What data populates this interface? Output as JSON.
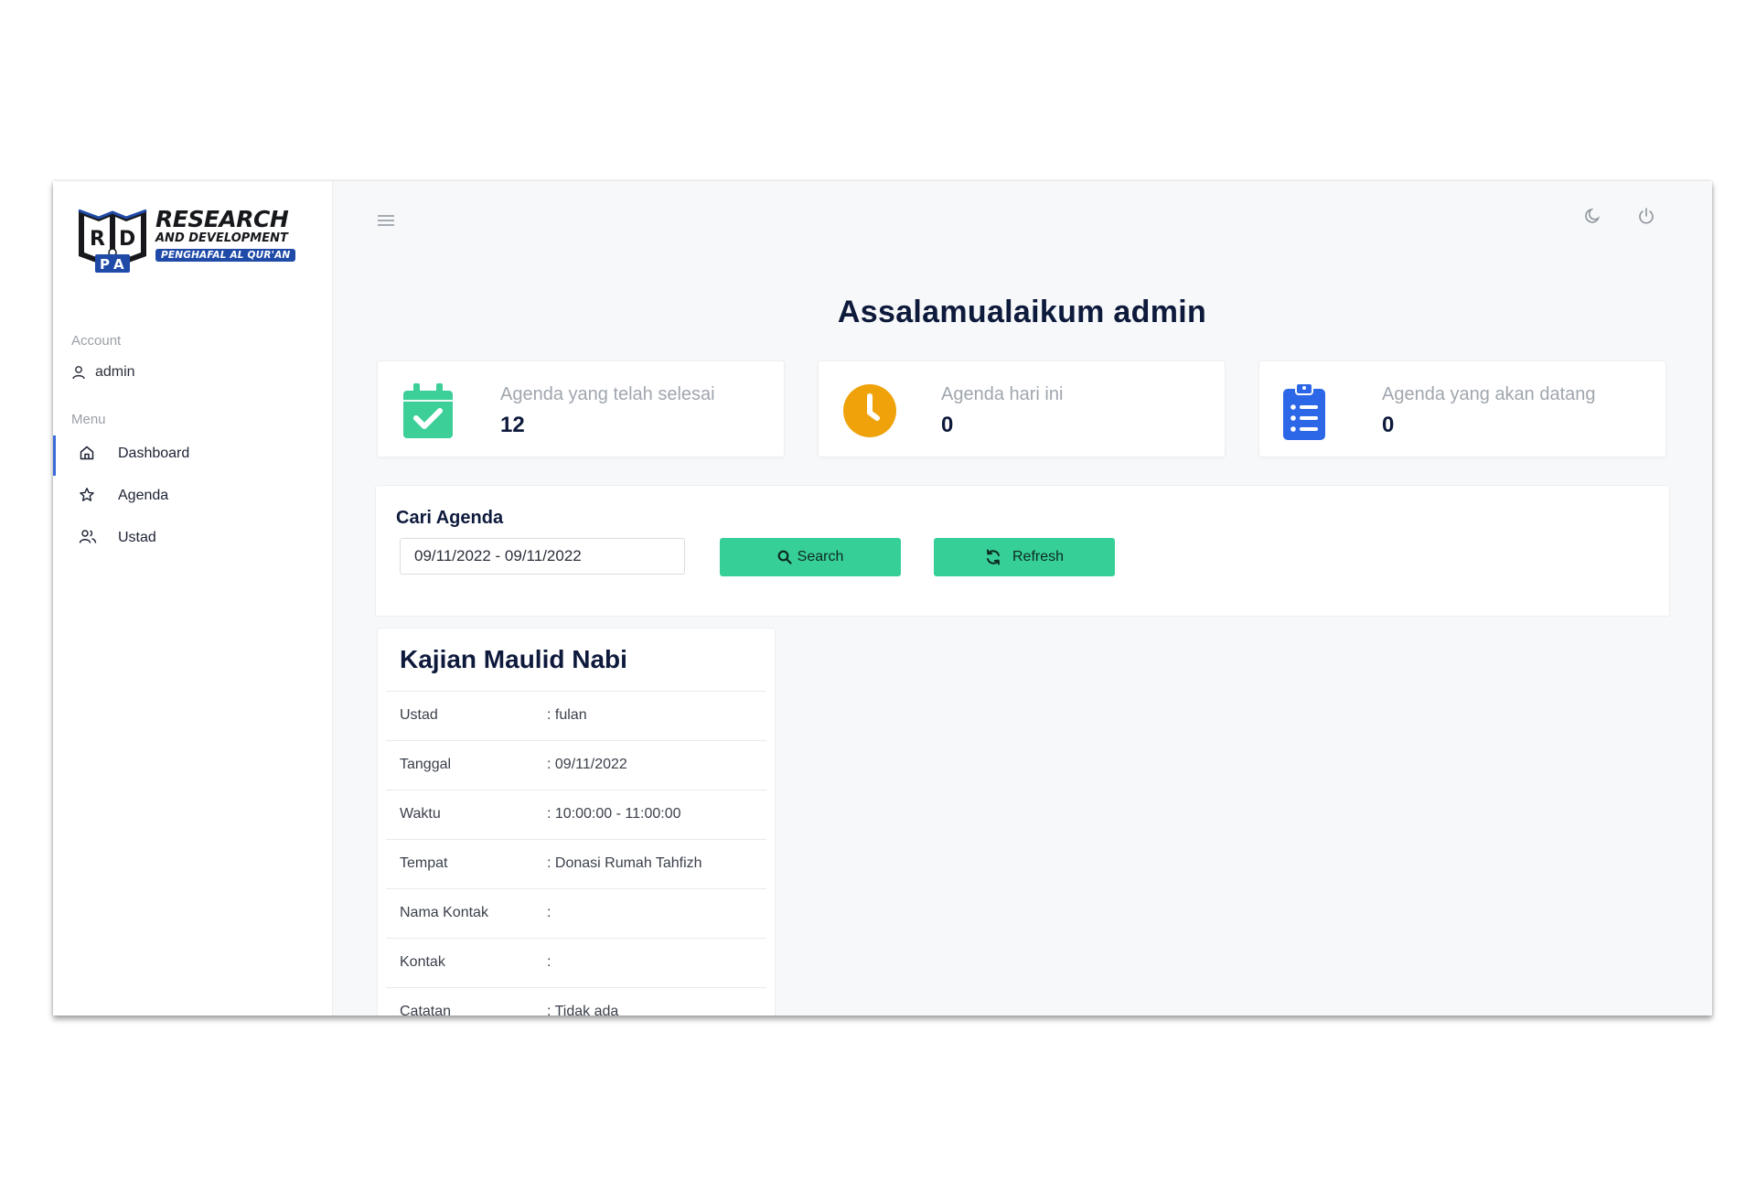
{
  "logo": {
    "line1": "RESEARCH",
    "line2": "AND DEVELOPMENT",
    "line3": "PENGHAFAL AL QUR'AN",
    "mark_letters": [
      "R",
      "D",
      "P",
      "A"
    ],
    "colors": {
      "dark": "#17181c",
      "blue": "#1f4aa8"
    }
  },
  "sidebar": {
    "account_heading": "Account",
    "username": "admin",
    "menu_heading": "Menu",
    "items": [
      {
        "label": "Dashboard",
        "icon": "home-icon",
        "active": true
      },
      {
        "label": "Agenda",
        "icon": "star-icon",
        "active": false
      },
      {
        "label": "Ustad",
        "icon": "users-icon",
        "active": false
      }
    ]
  },
  "topbar": {
    "icons": [
      "menu-icon",
      "moon-icon",
      "power-icon"
    ]
  },
  "greeting": "Assalamualaikum admin",
  "stats": [
    {
      "label": "Agenda yang telah selesai",
      "value": "12",
      "icon": "calendar-check-icon",
      "color": "#3ccf98"
    },
    {
      "label": "Agenda hari ini",
      "value": "0",
      "icon": "clock-icon",
      "color": "#f0a20a"
    },
    {
      "label": "Agenda yang akan datang",
      "value": "0",
      "icon": "clipboard-list-icon",
      "color": "#2c67e8"
    }
  ],
  "search": {
    "title": "Cari Agenda",
    "date_range_value": "09/11/2022 - 09/11/2022",
    "search_label": "Search",
    "refresh_label": "Refresh",
    "button_color": "#36cf97"
  },
  "agenda": {
    "title": "Kajian Maulid Nabi",
    "rows": [
      {
        "key": "Ustad",
        "value": ": fulan"
      },
      {
        "key": "Tanggal",
        "value": ": 09/11/2022"
      },
      {
        "key": "Waktu",
        "value": ": 10:00:00 - 11:00:00"
      },
      {
        "key": "Tempat",
        "value": ": Donasi Rumah Tahfizh"
      },
      {
        "key": "Nama Kontak",
        "value": ":"
      },
      {
        "key": "Kontak",
        "value": ":"
      },
      {
        "key": "Catatan",
        "value": ": Tidak ada"
      }
    ]
  }
}
